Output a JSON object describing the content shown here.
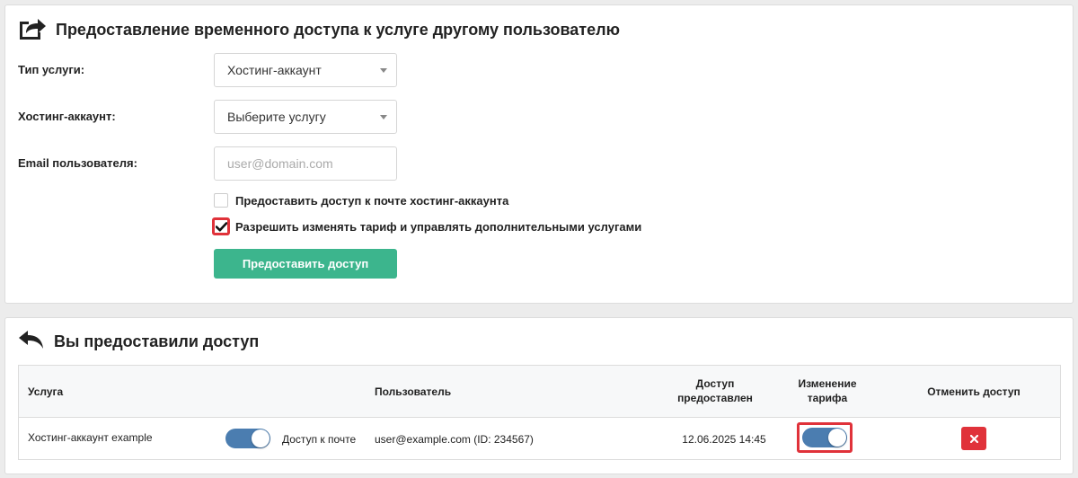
{
  "grant_panel": {
    "title": "Предоставление временного доступа к услуге другому пользователю",
    "title_icon": "share-external-icon",
    "service_type": {
      "label": "Тип услуги:",
      "value": "Хостинг-аккаунт"
    },
    "hosting_account": {
      "label": "Хостинг-аккаунт:",
      "value": "Выберите услугу"
    },
    "email": {
      "label": "Email пользователя:",
      "placeholder": "user@domain.com",
      "value": ""
    },
    "mail_access": {
      "label": "Предоставить доступ к почте хостинг-аккаунта",
      "checked": false
    },
    "tariff_access": {
      "label": "Разрешить изменять тариф и управлять дополнительными услугами",
      "checked": true
    },
    "submit_label": "Предоставить доступ"
  },
  "granted_panel": {
    "title": "Вы предоставили доступ",
    "title_icon": "reply-arrow-icon",
    "columns": {
      "service": "Услуга",
      "user": "Пользователь",
      "granted_line1": "Доступ",
      "granted_line2": "предоставлен",
      "tariff_line1": "Изменение",
      "tariff_line2": "тарифа",
      "cancel": "Отменить доступ"
    },
    "rows": [
      {
        "service": "Хостинг-аккаунт example",
        "mail_toggle_label": "Доступ к почте",
        "mail_toggle_on": true,
        "user": "user@example.com (ID: 234567)",
        "granted": "12.06.2025 14:45",
        "tariff_toggle_on": true,
        "cancel_icon": "close-icon"
      }
    ]
  },
  "colors": {
    "primary": "#3cb58d",
    "toggle": "#4b7db0",
    "danger": "#e0323a",
    "highlight": "#e0323a"
  }
}
